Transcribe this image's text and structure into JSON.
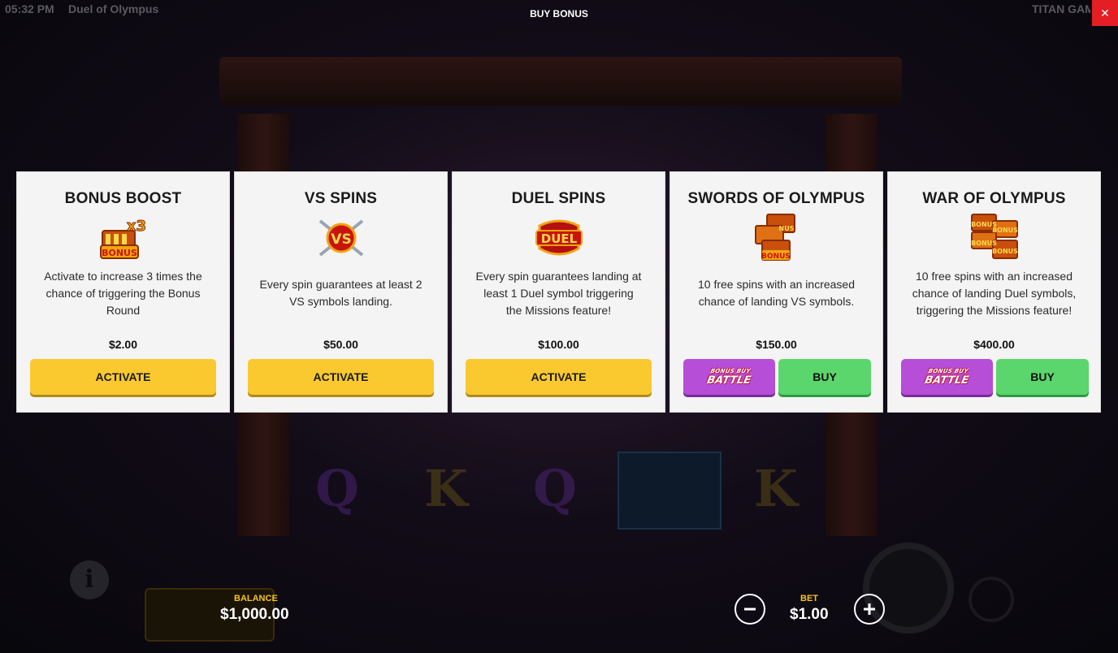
{
  "topbar": {
    "time": "05:32 PM",
    "game_name": "Duel of Olympus",
    "modal_title": "BUY BONUS",
    "provider": "TITAN GAM",
    "close_icon": "close-icon"
  },
  "colors": {
    "card_bg": "#f4f4f4",
    "activate": "#fac92f",
    "battle": "#b64ed8",
    "buy": "#5bd66d",
    "close": "#e31e24",
    "label_gold": "#f5c518"
  },
  "cards": [
    {
      "title": "BONUS BOOST",
      "icon": "bonus-x3-icon",
      "description": "Activate to increase 3 times the chance of triggering the Bonus Round",
      "price": "$2.00",
      "button": "ACTIVATE"
    },
    {
      "title": "VS SPINS",
      "icon": "vs-crossed-swords-icon",
      "description": "Every spin guarantees at least 2 VS symbols landing.",
      "price": "$50.00",
      "button": "ACTIVATE"
    },
    {
      "title": "DUEL SPINS",
      "icon": "duel-emblem-icon",
      "description": "Every spin guarantees landing at least 1 Duel symbol triggering the Missions feature!",
      "price": "$100.00",
      "button": "ACTIVATE"
    },
    {
      "title": "SWORDS OF OLYMPUS",
      "icon": "bonus-stack-icon",
      "description": "10 free spins with an increased chance of landing VS symbols.",
      "price": "$150.00",
      "battle_line1": "BONUS BUY",
      "battle_line2": "BATTLE",
      "button": "BUY"
    },
    {
      "title": "WAR OF OLYMPUS",
      "icon": "bonus-stack-icon",
      "description": "10 free spins with an increased chance of landing Duel symbols, triggering the Missions feature!",
      "price": "$400.00",
      "battle_line1": "BONUS BUY",
      "battle_line2": "BATTLE",
      "button": "BUY"
    }
  ],
  "bottombar": {
    "balance_label": "BALANCE",
    "balance_value": "$1,000.00",
    "bet_label": "BET",
    "bet_value": "$1.00",
    "minus_icon": "minus-icon",
    "plus_icon": "plus-icon"
  }
}
